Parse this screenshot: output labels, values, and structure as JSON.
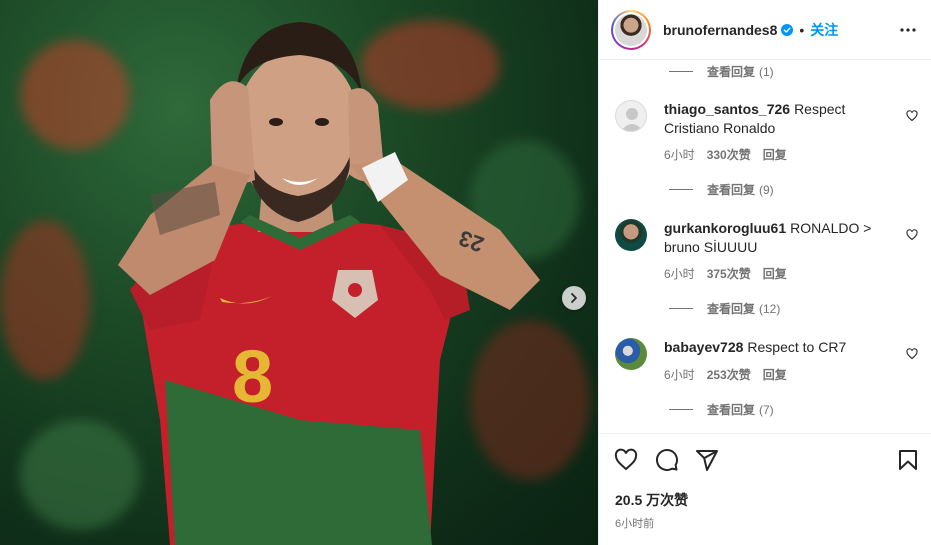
{
  "post": {
    "username": "brunofernandes8",
    "follow_label": "关注",
    "separator": "•",
    "jersey_number": "8",
    "tattoo_text": "23"
  },
  "comments": {
    "top_replies": {
      "label": "查看回复",
      "count": "(1)"
    },
    "items": [
      {
        "username": "thiago_santos_726",
        "text": "Respect Cristiano Ronaldo",
        "time": "6小时",
        "likes": "330次赞",
        "reply": "回复",
        "replies": {
          "label": "查看回复",
          "count": "(9)"
        }
      },
      {
        "username": "gurkankorogluu61",
        "text": "RONALDO > bruno SİUUUU",
        "time": "6小时",
        "likes": "375次赞",
        "reply": "回复",
        "replies": {
          "label": "查看回复",
          "count": "(12)"
        }
      },
      {
        "username": "babayev728",
        "text": "Respect to CR7",
        "time": "6小时",
        "likes": "253次赞",
        "reply": "回复",
        "replies": {
          "label": "查看回复",
          "count": "(7)"
        }
      }
    ]
  },
  "footer": {
    "likes": "20.5 万次赞",
    "time": "6小时前"
  },
  "icons": {
    "header": [
      "avatar",
      "verified-icon",
      "more-icon"
    ],
    "actions": [
      "heart-icon",
      "comment-icon",
      "share-icon",
      "bookmark-icon"
    ],
    "media": [
      "chevron-right-icon"
    ]
  },
  "colors": {
    "accent": "#0095f6",
    "text": "#262626",
    "muted": "#737373",
    "divider": "#efefef"
  }
}
